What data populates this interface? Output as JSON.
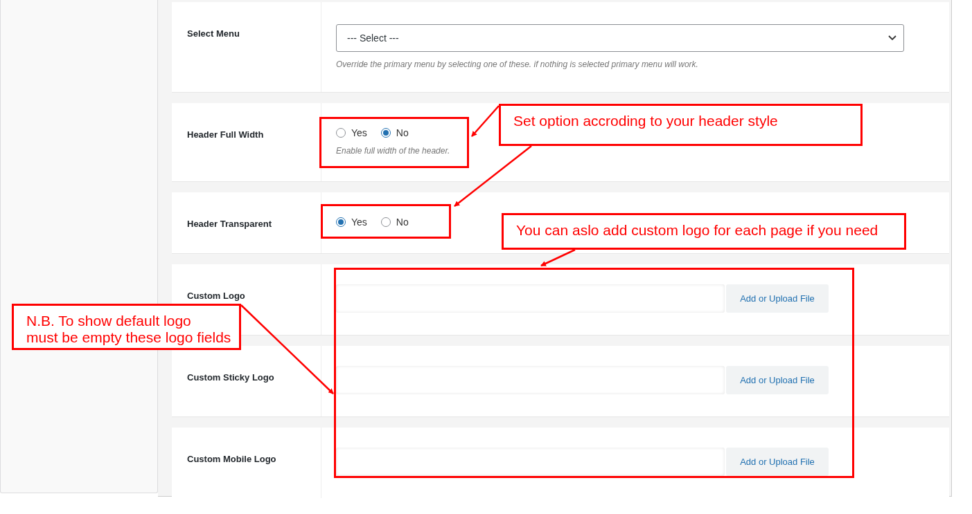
{
  "settings": [
    {
      "kind": "select",
      "label": "Select Menu",
      "value": "--- Select ---",
      "description": "Override the primary menu by selecting one of these. if nothing is selected primary menu will work."
    },
    {
      "kind": "radio",
      "label": "Header Full Width",
      "options": [
        {
          "label": "Yes",
          "selected": false
        },
        {
          "label": "No",
          "selected": true
        }
      ],
      "description": "Enable full width of the header."
    },
    {
      "kind": "radio",
      "label": "Header Transparent",
      "options": [
        {
          "label": "Yes",
          "selected": true
        },
        {
          "label": "No",
          "selected": false
        }
      ]
    },
    {
      "kind": "upload",
      "label": "Custom Logo",
      "button": "Add or Upload File"
    },
    {
      "kind": "upload",
      "label": "Custom Sticky Logo",
      "button": "Add or Upload File"
    },
    {
      "kind": "upload",
      "label": "Custom Mobile Logo",
      "button": "Add or Upload File"
    }
  ],
  "annotations": [
    {
      "lines": [
        "Set option accroding to your header style"
      ]
    },
    {
      "lines": [
        "You can aslo add custom logo for each page if you need"
      ]
    },
    {
      "lines": [
        "N.B. To show default logo",
        "must be empty these logo fields"
      ]
    }
  ]
}
